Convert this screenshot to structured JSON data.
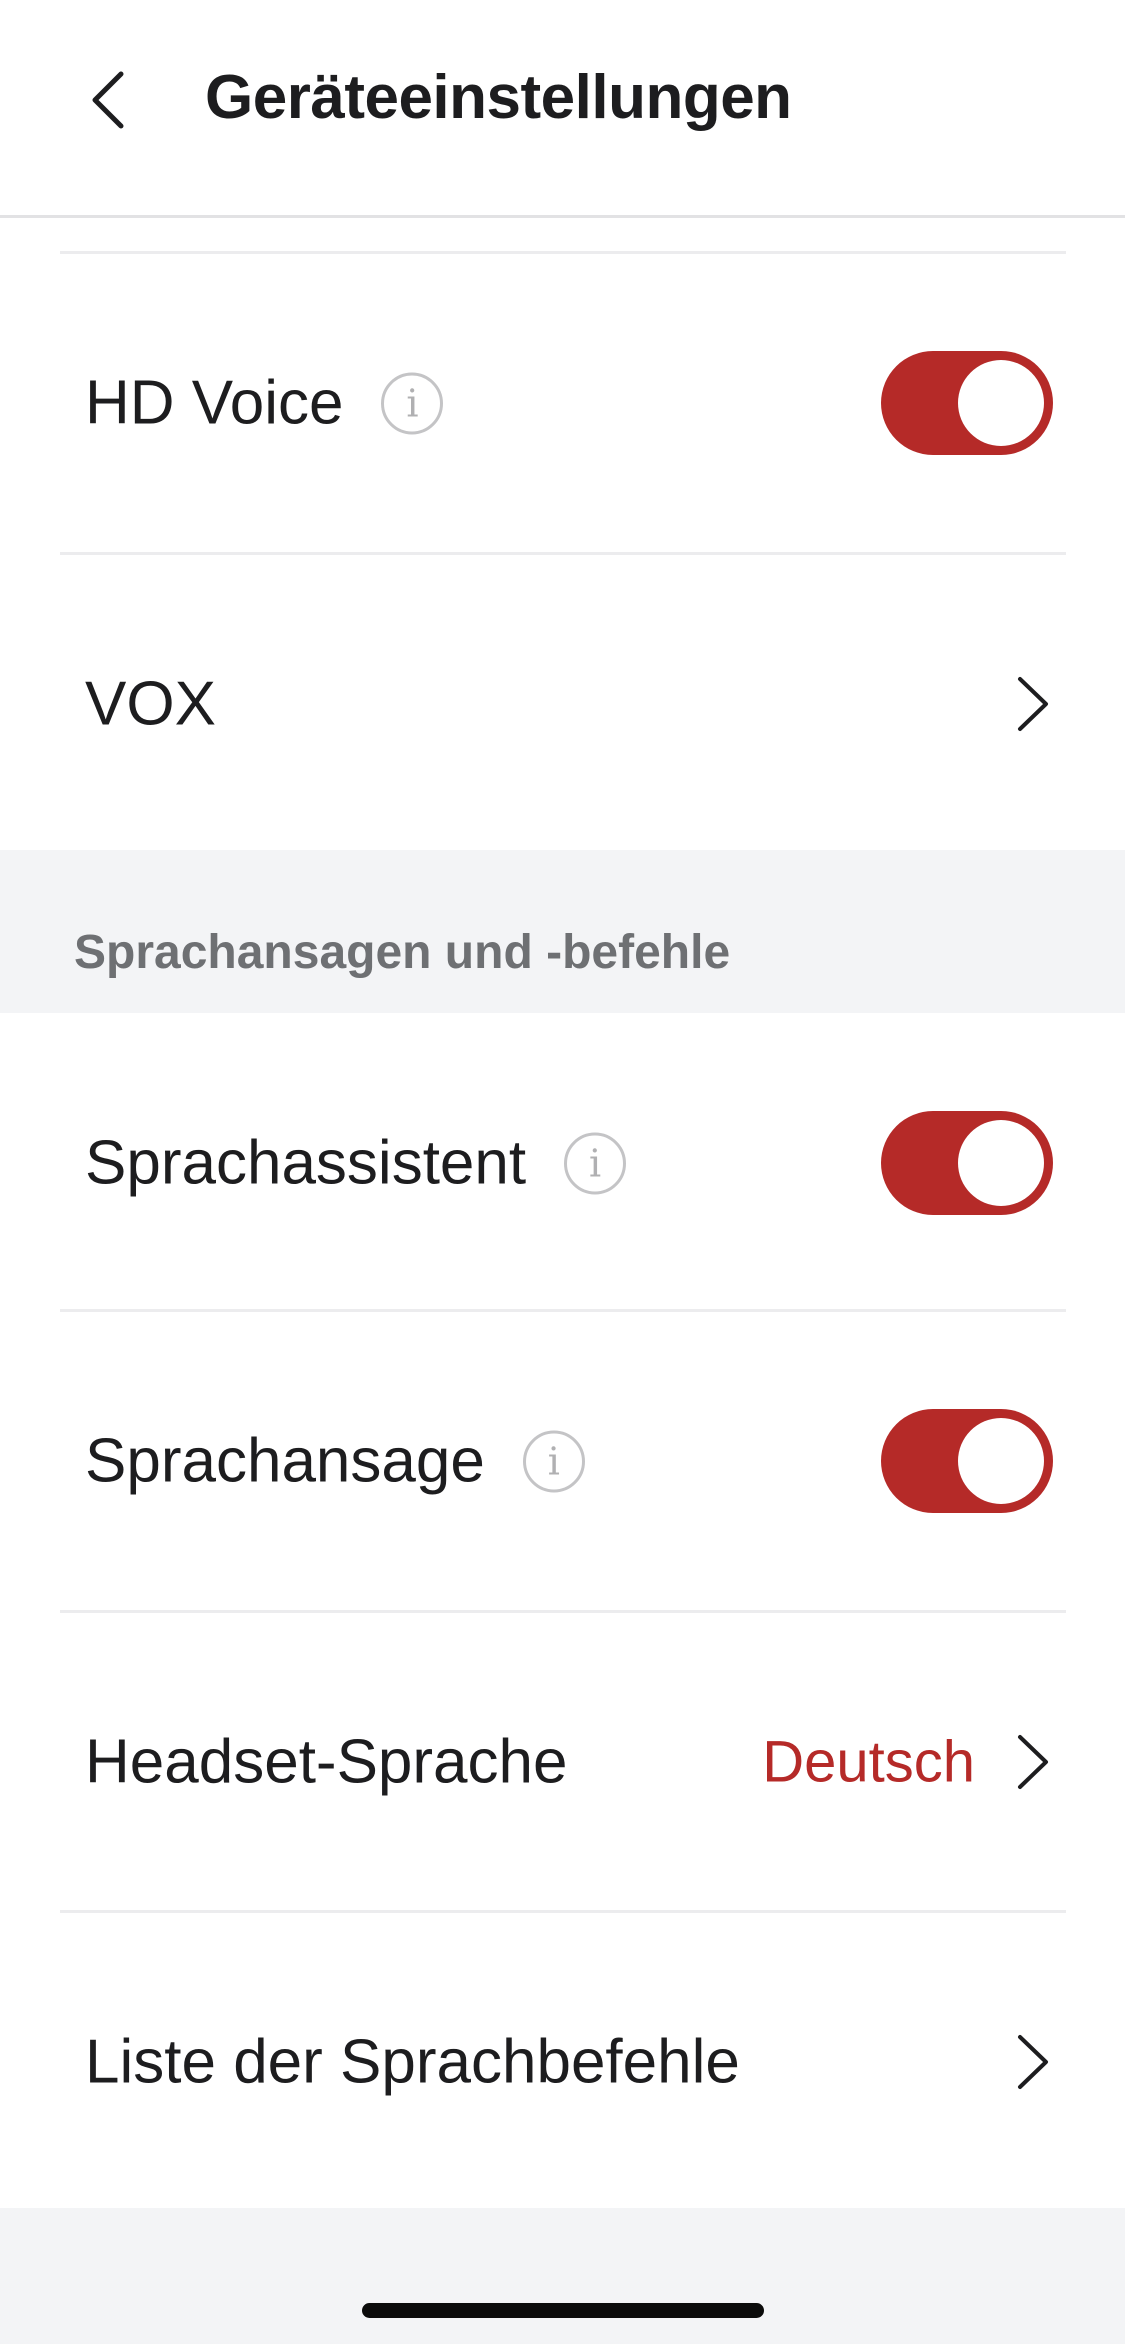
{
  "header": {
    "title": "Geräteeinstellungen",
    "back_icon": "chevron-left-icon"
  },
  "settings_top": [
    {
      "label": "HD Voice",
      "type": "toggle",
      "has_info": true,
      "on": true
    },
    {
      "label": "VOX",
      "type": "link"
    }
  ],
  "section": {
    "title": "Sprachansagen und -befehle"
  },
  "settings_bottom": [
    {
      "label": "Sprachassistent",
      "type": "toggle",
      "has_info": true,
      "on": true
    },
    {
      "label": "Sprachansage",
      "type": "toggle",
      "has_info": true,
      "on": true
    },
    {
      "label": "Headset-Sprache",
      "type": "link",
      "value": "Deutsch"
    },
    {
      "label": "Liste der Sprachbefehle",
      "type": "link"
    }
  ],
  "icons": {
    "info": "i"
  },
  "colors": {
    "accent": "#b52a28",
    "toggle_knob": "#ffffff",
    "section_header": "#6e7073",
    "background": "#f3f4f6"
  }
}
